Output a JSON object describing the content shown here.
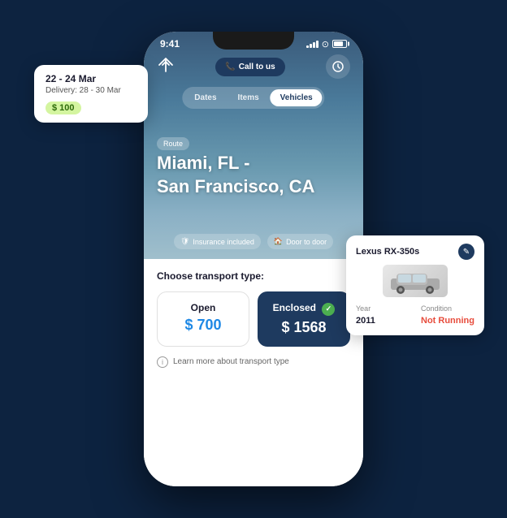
{
  "tooltip": {
    "dates": "22 - 24 Mar",
    "delivery_label": "Delivery: 28 - 30 Mar",
    "price": "$ 100"
  },
  "vehicle_card": {
    "title": "Lexus RX-350s",
    "year_label": "Year",
    "year_value": "2011",
    "condition_label": "Condition",
    "condition_value": "Not Running",
    "edit_icon": "✎"
  },
  "status_bar": {
    "time": "9:41"
  },
  "nav": {
    "call_btn": "Call to us",
    "phone_icon": "📞",
    "logo": "✈"
  },
  "tabs": [
    {
      "label": "Dates",
      "active": false
    },
    {
      "label": "Items",
      "active": false
    },
    {
      "label": "Vehicles",
      "active": true
    }
  ],
  "route": {
    "badge": "Route",
    "title_line1": "Miami, FL -",
    "title_line2": "San Francisco, CA"
  },
  "services": [
    {
      "label": "Insurance included",
      "icon": "🛡"
    },
    {
      "label": "Door to door",
      "icon": "🏠"
    }
  ],
  "content": {
    "transport_label": "Choose transport type:",
    "transport_types": [
      {
        "title": "Open",
        "price": "$ 700",
        "selected": false
      },
      {
        "title": "Enclosed",
        "price": "$ 1568",
        "selected": true
      }
    ],
    "info_text": "Learn more about transport type"
  }
}
